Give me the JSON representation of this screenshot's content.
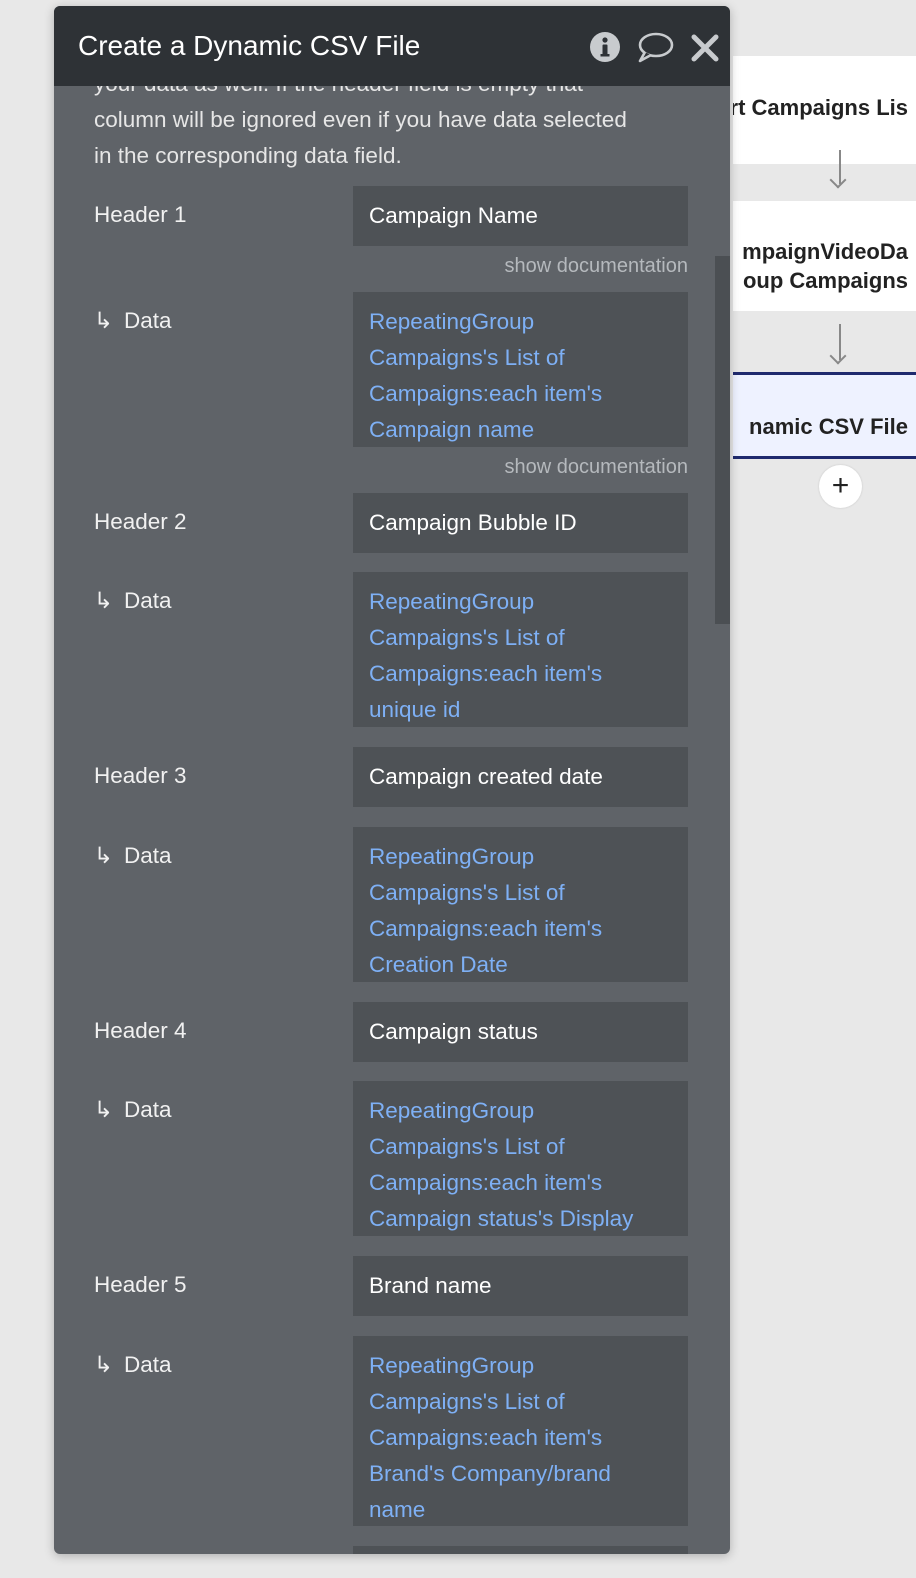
{
  "workflow": {
    "steps": [
      {
        "label": "rt Campaigns Lis"
      },
      {
        "label_line1": "mpaignVideoDa",
        "label_line2": "oup Campaigns"
      },
      {
        "label": "namic CSV File"
      }
    ],
    "add_symbol": "+"
  },
  "panel": {
    "title": "Create a Dynamic CSV File",
    "description_line1": "your data as well. If the header field is empty that",
    "description_line2": "column will be ignored even if you have data selected",
    "description_line3": "in the corresponding data field.",
    "show_doc_label": "show documentation",
    "data_label": "Data",
    "data_arrow": "↳",
    "rows": [
      {
        "header_label": "Header 1",
        "header_value": "Campaign Name",
        "data_lines": [
          "RepeatingGroup",
          "Campaigns's List of",
          "Campaigns:each item's",
          "Campaign name"
        ]
      },
      {
        "header_label": "Header 2",
        "header_value": "Campaign Bubble ID",
        "data_lines": [
          "RepeatingGroup",
          "Campaigns's List of",
          "Campaigns:each item's",
          "unique id"
        ]
      },
      {
        "header_label": "Header 3",
        "header_value": "Campaign created date",
        "data_lines": [
          "RepeatingGroup",
          "Campaigns's List of",
          "Campaigns:each item's",
          "Creation Date"
        ]
      },
      {
        "header_label": "Header 4",
        "header_value": "Campaign status",
        "data_lines": [
          "RepeatingGroup",
          "Campaigns's List of",
          "Campaigns:each item's",
          "Campaign status's Display"
        ]
      },
      {
        "header_label": "Header 5",
        "header_value": "Brand name",
        "data_lines": [
          "RepeatingGroup",
          "Campaigns's List of",
          "Campaigns:each item's",
          "Brand's Company/brand",
          "name"
        ]
      }
    ]
  },
  "colors": {
    "panel_bg": "#5f6368",
    "header_bg": "#2e3236",
    "field_bg": "#4e5256",
    "expression_text": "#7eb0f5",
    "selected_step_border": "#1f2a6e"
  }
}
